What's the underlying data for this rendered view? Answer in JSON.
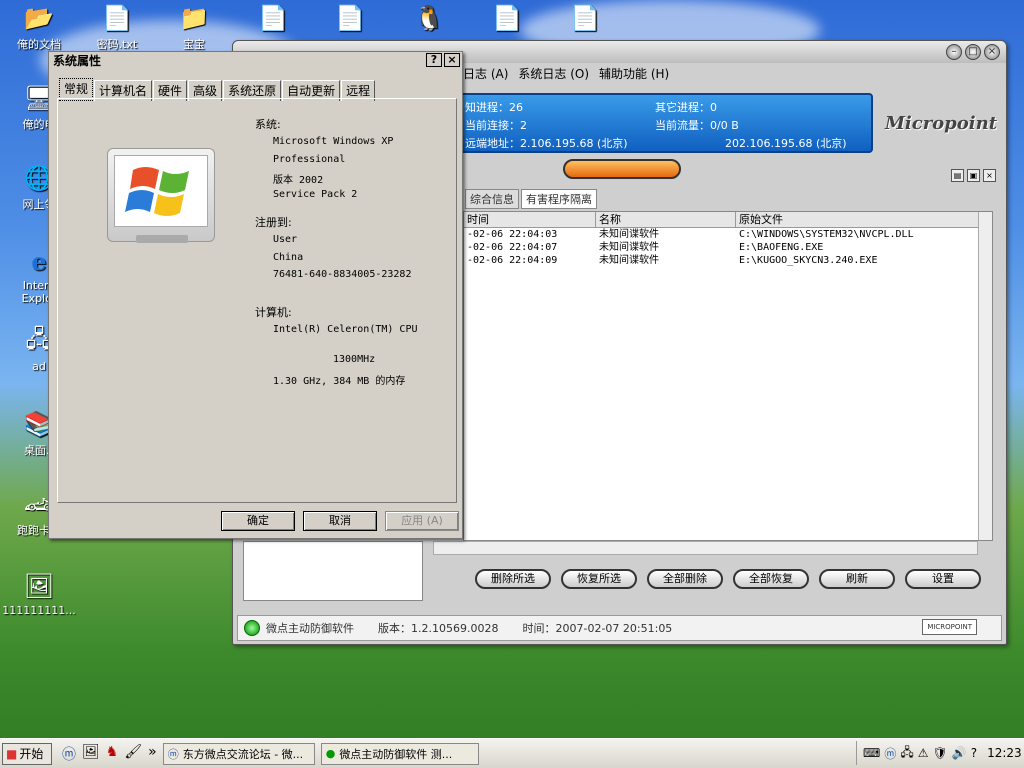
{
  "desktop": {
    "icons": [
      {
        "label": "俺的文档",
        "icon": "folder-docs-icon"
      },
      {
        "label": "密码.txt",
        "icon": "text-file-icon"
      },
      {
        "label": "宝宝",
        "icon": "folder-icon"
      },
      {
        "label": "俺的电",
        "icon": "computer-icon"
      },
      {
        "label": "网上邻",
        "icon": "network-icon"
      },
      {
        "label": "Intern",
        "icon": "ie-icon"
      },
      {
        "label": "Explor",
        "icon": "ie-icon"
      },
      {
        "label": "ad",
        "icon": "network-icon"
      },
      {
        "label": "桌面.r",
        "icon": "rar-icon"
      },
      {
        "label": "跑跑卡丁",
        "icon": "game-icon"
      },
      {
        "label": "111111111...",
        "icon": "image-file-icon"
      }
    ]
  },
  "micropoint": {
    "menu": [
      "日志 (A)",
      "系统日志 (O)",
      "辅助功能 (H)"
    ],
    "banner": {
      "process_label": "知进程：26",
      "other_process": "其它进程：0",
      "connections": "当前连接：2",
      "traffic": "当前流量：0/0 B",
      "remote_addr": "远端地址：2.106.195.68 (北京)",
      "local_addr": "202.106.195.68 (北京)"
    },
    "logo": "Micropoint",
    "tabs": [
      "综合信息",
      "有害程序隔离"
    ],
    "table": {
      "headers": [
        "时间",
        "名称",
        "原始文件"
      ],
      "rows": [
        [
          "-02-06 22:04:03",
          "未知间谍软件",
          "C:\\WINDOWS\\SYSTEM32\\NVCPL.DLL"
        ],
        [
          "-02-06 22:04:07",
          "未知间谍软件",
          "E:\\BAOFENG.EXE"
        ],
        [
          "-02-06 22:04:09",
          "未知间谍软件",
          "E:\\KUGOO_SKYCN3.240.EXE"
        ]
      ]
    },
    "actions": [
      "删除所选",
      "恢复所选",
      "全部删除",
      "全部恢复",
      "刷新",
      "设置"
    ],
    "status": {
      "app": "微点主动防御软件",
      "version": "版本：1.2.10569.0028",
      "time": "时间：2007-02-07 20:51:05",
      "mini": "MICROPOINT"
    }
  },
  "dialog": {
    "title": "系统属性",
    "help": "?",
    "close": "×",
    "tabs": [
      "常规",
      "计算机名",
      "硬件",
      "高级",
      "系统还原",
      "自动更新",
      "远程"
    ],
    "system_label": "系统:",
    "system_lines": [
      "Microsoft Windows XP",
      "Professional",
      "版本 2002",
      "Service Pack 2"
    ],
    "reg_label": "注册到:",
    "reg_lines": [
      "User",
      "China",
      "76481-640-8834005-23282"
    ],
    "computer_label": "计算机:",
    "cpu": "Intel(R) Celeron(TM) CPU",
    "mhz": "1300MHz",
    "mem": "1.30 GHz, 384 MB 的内存",
    "buttons": {
      "ok": "确定",
      "cancel": "取消",
      "apply": "应用 (A)"
    }
  },
  "taskbar": {
    "start": "开始",
    "tasks": [
      "东方微点交流论坛 - 微...",
      "微点主动防御软件  测..."
    ],
    "clock": "12:23"
  }
}
